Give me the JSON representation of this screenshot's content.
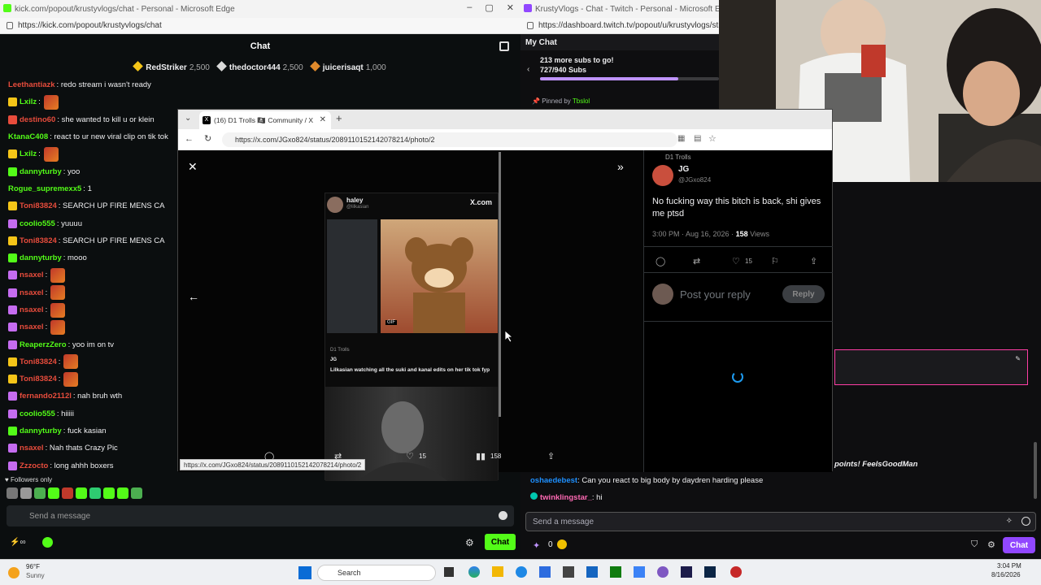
{
  "kick": {
    "window_title": "kick.com/popout/krustyvlogs/chat - Personal - Microsoft Edge",
    "url": "https://kick.com/popout/krustyvlogs/chat",
    "header": "Chat",
    "leaderboard": [
      {
        "name": "RedStriker",
        "count": "2,500",
        "color": "#f5c518"
      },
      {
        "name": "thedoctor444",
        "count": "2,500",
        "color": "#d9d9d9"
      },
      {
        "name": "juicerisaqt",
        "count": "1,000",
        "color": "#e08a2c"
      }
    ],
    "messages": [
      {
        "user": "Leethantiazk",
        "text": ": redo stream i wasn't ready",
        "color": "#e74c3c",
        "badge": ""
      },
      {
        "user": "Lxilz",
        "text": ":",
        "color": "#53fc18",
        "badge": "14",
        "emote": true
      },
      {
        "user": "destino60",
        "text": ": she wanted to kill u or klein",
        "color": "#e74c3c",
        "badge": "x"
      },
      {
        "user": "KtanaC408",
        "text": ": react to ur new viral clip on tik tok",
        "color": "#53fc18",
        "badge": ""
      },
      {
        "user": "Lxilz",
        "text": ":",
        "color": "#53fc18",
        "badge": "14",
        "emote": true
      },
      {
        "user": "dannyturby",
        "text": ": yoo",
        "color": "#53fc18",
        "badge": "g"
      },
      {
        "user": "Rogue_supremexx5",
        "text": ": 1",
        "color": "#53fc18",
        "badge": ""
      },
      {
        "user": "Toni83824",
        "text": ": SEARCH UP FIRE MENS CA",
        "color": "#e74c3c",
        "badge": "14"
      },
      {
        "user": "coolio555",
        "text": ": yuuuu",
        "color": "#53fc18",
        "badge": "p"
      },
      {
        "user": "Toni83824",
        "text": ": SEARCH UP FIRE MENS CA",
        "color": "#e74c3c",
        "badge": "14"
      },
      {
        "user": "dannyturby",
        "text": ": mooo",
        "color": "#53fc18",
        "badge": "g"
      },
      {
        "user": "nsaxel",
        "text": ":",
        "color": "#e74c3c",
        "badge": "p",
        "emote": true
      },
      {
        "user": "nsaxel",
        "text": ":",
        "color": "#e74c3c",
        "badge": "p",
        "emote": true
      },
      {
        "user": "nsaxel",
        "text": ":",
        "color": "#e74c3c",
        "badge": "p",
        "emote": true
      },
      {
        "user": "nsaxel",
        "text": ":",
        "color": "#e74c3c",
        "badge": "p",
        "emote": true
      },
      {
        "user": "ReaperzZero",
        "text": ": yoo im on tv",
        "color": "#53fc18",
        "badge": "p"
      },
      {
        "user": "Toni83824",
        "text": ":",
        "color": "#e74c3c",
        "badge": "14",
        "emote": true
      },
      {
        "user": "Toni83824",
        "text": ":",
        "color": "#e74c3c",
        "badge": "14",
        "emote": true
      },
      {
        "user": "fernando2112l",
        "text": ": nah bruh wth",
        "color": "#e74c3c",
        "badge": "p"
      },
      {
        "user": "coolio555",
        "text": ": hiiiii",
        "color": "#53fc18",
        "badge": "p"
      },
      {
        "user": "dannyturby",
        "text": ": fuck kasian",
        "color": "#53fc18",
        "badge": "g"
      },
      {
        "user": "nsaxel",
        "text": ": Nah thats Crazy Pic",
        "color": "#e74c3c",
        "badge": "p"
      },
      {
        "user": "Zzzocto",
        "text": ": long ahhh boxers",
        "color": "#e74c3c",
        "badge": "p"
      }
    ],
    "followers_only": "Followers only",
    "input_placeholder": "Send a message",
    "chat_button": "Chat"
  },
  "twitch": {
    "window_title": "KrustyVlogs - Chat - Twitch - Personal - Microsoft Edge",
    "url": "https://dashboard.twitch.tv/popout/u/krustyvlogs/stre",
    "my_chat": "My Chat",
    "sub_goal_line1": "213 more subs to go!",
    "sub_goal_line2": "727/940 Subs",
    "sub_goal_progress": 0.773,
    "pinned": "Pinned by",
    "pinned_user": "Tbslol",
    "highlight_text": "points! FeelsGoodMan",
    "messages": [
      {
        "user": "oshaedebest",
        "text": ": Can you react to big body by daydren harding please",
        "color": "#1e90ff"
      },
      {
        "user": "twinklingstar_",
        "text": ": hi",
        "color": "#ff69b4"
      }
    ],
    "input_placeholder": "Send a message",
    "points": "0",
    "chat_button": "Chat"
  },
  "xpopup": {
    "tab_title": "(16) D1 Trolls 🏴‍☠️ Community / X",
    "url": "https://x.com/JGxo824/status/2089110152142078214/photo/2",
    "tweet_author": "JG",
    "tweet_handle": "@JGxo824",
    "community": "D1 Trolls",
    "tweet_text": "No fucking way this bitch is back, shi gives me ptsd",
    "tweet_time": "3:00 PM · Aug 16, 2026 ·",
    "tweet_views_num": "158",
    "tweet_views_label": "Views",
    "likes": "15",
    "views": "158",
    "reply_placeholder": "Post your reply",
    "reply_button": "Reply",
    "inner_user": "haley",
    "inner_handle": "@lilkasian",
    "inner_brand": "X.com",
    "inner_caption": "Lilkasian watching all the suki and kanal edits on her tik tok fyp",
    "inner_gif": "GIF",
    "hover_url": "https://x.com/JGxo824/status/2089110152142078214/photo/2"
  },
  "taskbar": {
    "weather_temp": "96°F",
    "weather_desc": "Sunny",
    "search": "Search",
    "time": "3:04 PM",
    "date": "8/16/2026"
  }
}
